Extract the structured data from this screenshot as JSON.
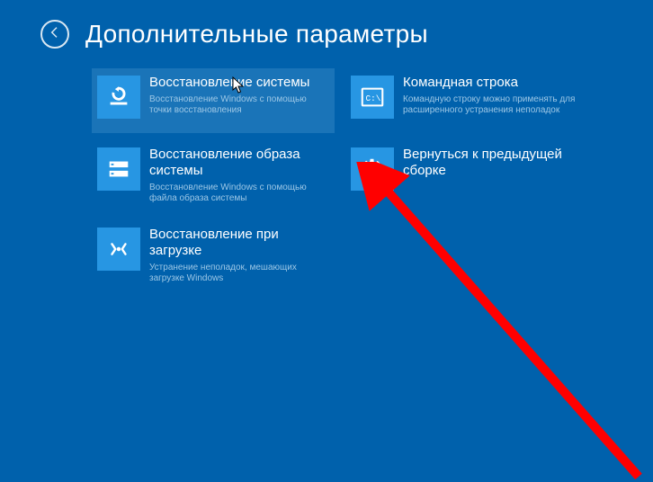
{
  "header": {
    "title": "Дополнительные параметры"
  },
  "tiles": [
    {
      "id": "system-restore",
      "label": "Восстановление системы",
      "desc": "Восстановление Windows с помощью точки восстановления",
      "selected": true
    },
    {
      "id": "command-prompt",
      "label": "Командная строка",
      "desc": "Командную строку можно применять для расширенного устранения неполадок",
      "selected": false
    },
    {
      "id": "system-image-recovery",
      "label": "Восстановление образа системы",
      "desc": "Восстановление Windows с помощью файла образа системы",
      "selected": false
    },
    {
      "id": "go-back-build",
      "label": "Вернуться к предыдущей сборке",
      "desc": "",
      "selected": false
    },
    {
      "id": "startup-repair",
      "label": "Восстановление при загрузке",
      "desc": "Устранение неполадок, мешающих загрузке Windows",
      "selected": false
    }
  ]
}
